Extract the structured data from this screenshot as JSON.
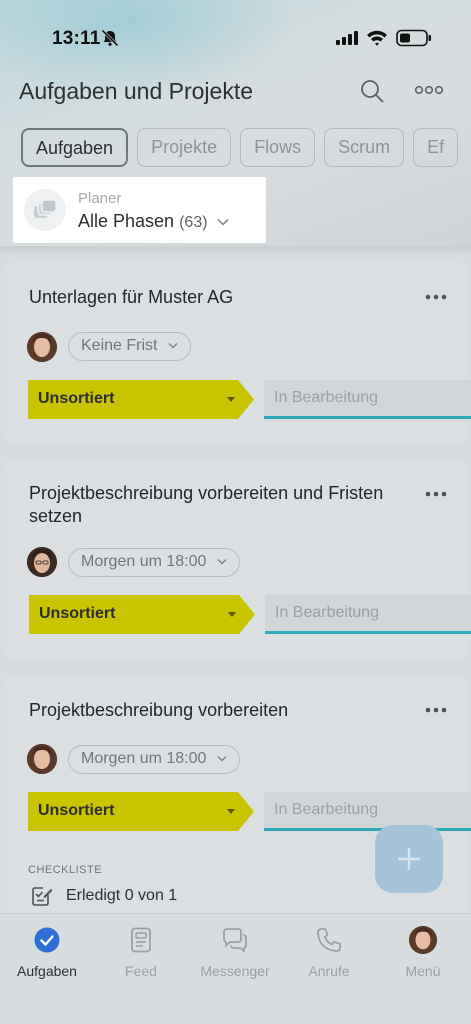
{
  "status_bar": {
    "time": "13:11"
  },
  "header": {
    "title": "Aufgaben und Projekte"
  },
  "tabs": [
    {
      "label": "Aufgaben",
      "active": true
    },
    {
      "label": "Projekte",
      "active": false
    },
    {
      "label": "Flows",
      "active": false
    },
    {
      "label": "Scrum",
      "active": false
    },
    {
      "label": "Ef",
      "active": false
    }
  ],
  "planner": {
    "label": "Planer",
    "value": "Alle Phasen",
    "count": "(63)"
  },
  "tasks": [
    {
      "title": "Unterlagen für Muster AG",
      "deadline": "Keine Frist",
      "stage": "Unsortiert",
      "next_stage": "In Bearbeitung"
    },
    {
      "title": "Projektbeschreibung vorbereiten und Fristen setzen",
      "deadline": "Morgen um 18:00",
      "stage": "Unsortiert",
      "next_stage": "In Bearbeitung"
    },
    {
      "title": "Projektbeschreibung vorbereiten",
      "deadline": "Morgen um 18:00",
      "stage": "Unsortiert",
      "next_stage": "In Bearbeitung",
      "checklist": {
        "heading": "CHECKLISTE",
        "status": "Erledigt 0 von 1"
      }
    }
  ],
  "tabbar": [
    {
      "label": "Aufgaben",
      "icon": "check-circle-icon",
      "active": true
    },
    {
      "label": "Feed",
      "icon": "feed-icon",
      "active": false
    },
    {
      "label": "Messenger",
      "icon": "chat-icon",
      "active": false
    },
    {
      "label": "Anrufe",
      "icon": "phone-icon",
      "active": false
    },
    {
      "label": "Menü",
      "icon": "avatar",
      "active": false
    }
  ],
  "colors": {
    "accent": "#2d6fd6",
    "stage_current": "#c8c400",
    "stage_next_underline": "#2ea9b8",
    "fab": "#a5c4d9"
  }
}
